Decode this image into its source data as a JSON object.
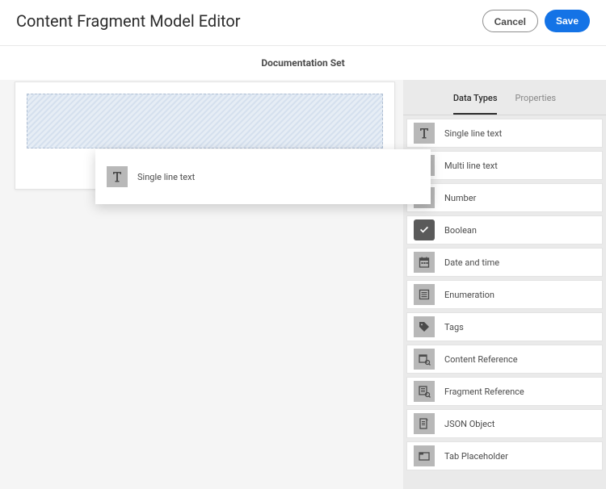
{
  "header": {
    "title": "Content Fragment Model Editor",
    "cancel_label": "Cancel",
    "save_label": "Save"
  },
  "subheader": "Documentation Set",
  "drag": {
    "label": "Single line text"
  },
  "sidebar": {
    "tabs": {
      "data_types": "Data Types",
      "properties": "Properties"
    },
    "types": [
      {
        "label": "Single line text"
      },
      {
        "label": "Multi line text"
      },
      {
        "label": "Number"
      },
      {
        "label": "Boolean"
      },
      {
        "label": "Date and time"
      },
      {
        "label": "Enumeration"
      },
      {
        "label": "Tags"
      },
      {
        "label": "Content Reference"
      },
      {
        "label": "Fragment Reference"
      },
      {
        "label": "JSON Object"
      },
      {
        "label": "Tab Placeholder"
      }
    ]
  }
}
